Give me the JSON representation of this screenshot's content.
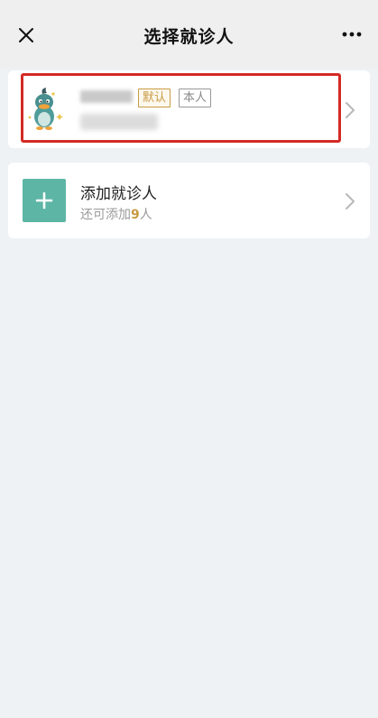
{
  "header": {
    "title": "选择就诊人",
    "close_icon": "close-icon",
    "more_icon": "more-horizontal-icon"
  },
  "patient_card": {
    "tags": {
      "default": "默认",
      "self": "本人"
    },
    "avatar_icon": "duck-mascot-avatar",
    "chevron_icon": "chevron-right-icon",
    "highlight_color": "#d32a24"
  },
  "add_card": {
    "title": "添加就诊人",
    "subtitle_prefix": "还可添加",
    "remaining_count": "9",
    "subtitle_suffix": "人",
    "icon": "plus-icon",
    "icon_bg": "#5db5a5",
    "chevron_icon": "chevron-right-icon"
  },
  "colors": {
    "accent_gold": "#c89a43",
    "background": "#eef2f5"
  }
}
